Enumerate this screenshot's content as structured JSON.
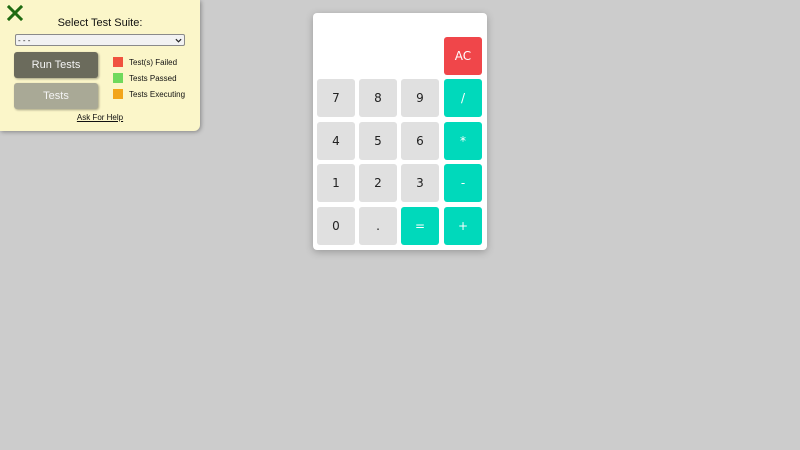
{
  "test_panel": {
    "title": "Select Test Suite:",
    "suite_select": {
      "selected": "- - -"
    },
    "buttons": {
      "run_tests": "Run Tests",
      "tests": "Tests"
    },
    "legend": [
      {
        "label": "Test(s) Failed",
        "color": "#f0523f"
      },
      {
        "label": "Tests Passed",
        "color": "#6fd95c"
      },
      {
        "label": "Tests Executing",
        "color": "#f2a51a"
      }
    ],
    "help_link": "Ask For Help",
    "close_icon": "close-icon",
    "close_color": "#1f6b12"
  },
  "calculator": {
    "display": "",
    "keys": {
      "ac": "AC",
      "seven": "7",
      "eight": "8",
      "nine": "9",
      "divide": "/",
      "four": "4",
      "five": "5",
      "six": "6",
      "multiply": "*",
      "one": "1",
      "two": "2",
      "three": "3",
      "subtract": "-",
      "zero": "0",
      "decimal": ".",
      "equals": "=",
      "add": "+"
    },
    "colors": {
      "number_key": "#e0e0e0",
      "operator_key": "#00d9bb",
      "clear_key": "#f0464a"
    }
  }
}
